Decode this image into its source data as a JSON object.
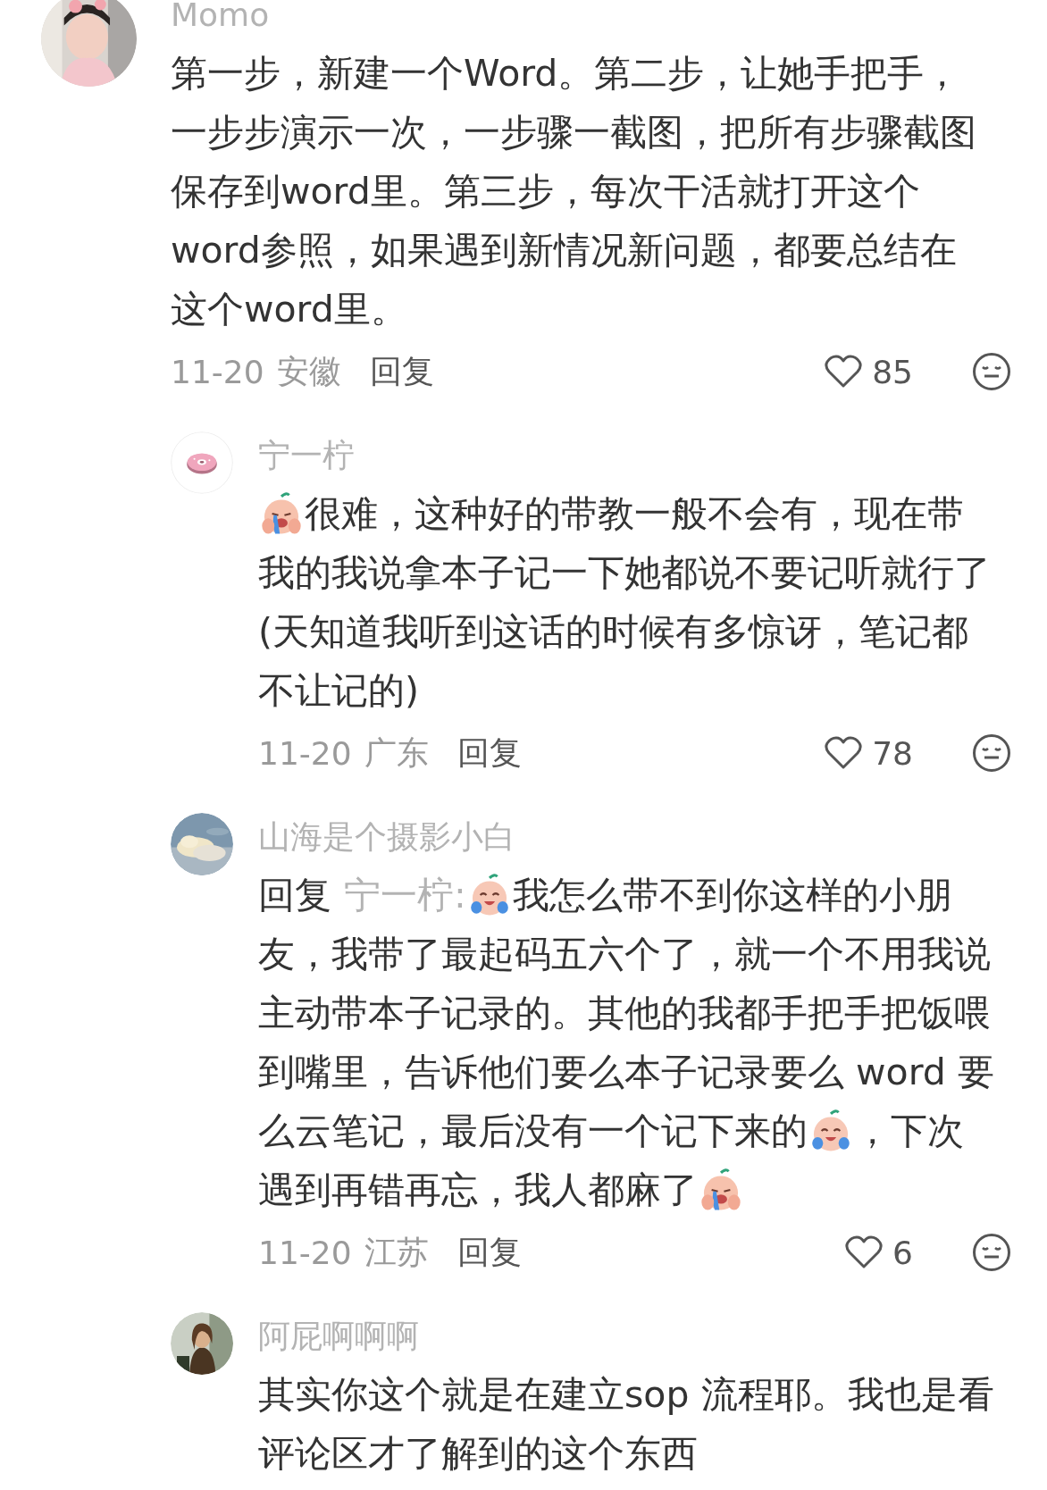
{
  "comments": [
    {
      "author": "Momo",
      "lines": [
        [
          {
            "kind": "text",
            "text": "第一步，新建一个Word。第二步，让她手把手，"
          }
        ],
        [
          {
            "kind": "text",
            "text": "一步步演示一次，一步骤一截图，把所有步骤截图"
          }
        ],
        [
          {
            "kind": "text",
            "text": "保存到word里。第三步，每次干活就打开这个"
          }
        ],
        [
          {
            "kind": "text",
            "text": "word参照，如果遇到新情况新问题，都要总结在"
          }
        ],
        [
          {
            "kind": "text",
            "text": "这个word里。"
          }
        ]
      ],
      "date": "11-20",
      "region": "安徽",
      "reply_label": "回复",
      "likes": "85",
      "replies": [
        {
          "author": "宁一柠",
          "lines": [
            [
              {
                "kind": "sob"
              },
              {
                "kind": "text",
                "text": "很难，这种好的带教一般不会有，现在带"
              }
            ],
            [
              {
                "kind": "text",
                "text": "我的我说拿本子记一下她都说不要记听就行了"
              }
            ],
            [
              {
                "kind": "text",
                "text": "(天知道我听到这话的时候有多惊讶，笔记都"
              }
            ],
            [
              {
                "kind": "text",
                "text": "不让记的)"
              }
            ]
          ],
          "date": "11-20",
          "region": "广东",
          "reply_label": "回复",
          "likes": "78"
        },
        {
          "author": "山海是个摄影小白",
          "lines": [
            [
              {
                "kind": "text",
                "text": "回复"
              },
              {
                "kind": "mention",
                "text": "宁一柠:"
              },
              {
                "kind": "laugh"
              },
              {
                "kind": "text",
                "text": "我怎么带不到你这样的小朋"
              }
            ],
            [
              {
                "kind": "text",
                "text": "友，我带了最起码五六个了，就一个不用我说"
              }
            ],
            [
              {
                "kind": "text",
                "text": "主动带本子记录的。其他的我都手把手把饭喂"
              }
            ],
            [
              {
                "kind": "text",
                "text": "到嘴里，告诉他们要么本子记录要么 word 要"
              }
            ],
            [
              {
                "kind": "text",
                "text": "么云笔记，最后没有一个记下来的"
              },
              {
                "kind": "laugh"
              },
              {
                "kind": "text",
                "text": "，下次"
              }
            ],
            [
              {
                "kind": "text",
                "text": "遇到再错再忘，我人都麻了"
              },
              {
                "kind": "sob"
              }
            ]
          ],
          "date": "11-20",
          "region": "江苏",
          "reply_label": "回复",
          "likes": "6"
        },
        {
          "author": "阿屁啊啊啊",
          "lines": [
            [
              {
                "kind": "text",
                "text": "其实你这个就是在建立sop 流程耶。我也是看"
              }
            ],
            [
              {
                "kind": "text",
                "text": "评论区才了解到的这个东西"
              }
            ]
          ]
        }
      ]
    }
  ]
}
